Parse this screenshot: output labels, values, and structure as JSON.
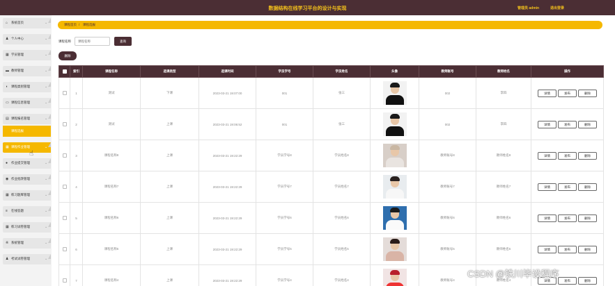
{
  "header": {
    "title": "数据结构在线学习平台的设计与实现",
    "user": "管理员 admin",
    "logout": "退出登录"
  },
  "sidebar": {
    "items": [
      {
        "label": "系统首页",
        "icon": "home-icon",
        "glyph": "⌂"
      },
      {
        "label": "个人中心",
        "icon": "user-icon",
        "glyph": "♟"
      },
      {
        "label": "学员管理",
        "icon": "grid-icon",
        "glyph": "▦"
      },
      {
        "label": "教师管理",
        "icon": "card-icon",
        "glyph": "▬"
      },
      {
        "label": "课程类别管理",
        "icon": "bullet-icon",
        "glyph": "◖"
      },
      {
        "label": "课程信息管理",
        "icon": "folder-icon",
        "glyph": "▭"
      },
      {
        "label": "课程报名管理",
        "icon": "doc-icon",
        "glyph": "▤"
      },
      {
        "label": "课程作业管理",
        "icon": "grid-icon",
        "glyph": "▦"
      },
      {
        "label": "作业提交管理",
        "icon": "drop-icon",
        "glyph": "●"
      },
      {
        "label": "作业批改管理",
        "icon": "chat-icon",
        "glyph": "◉"
      },
      {
        "label": "练习题库管理",
        "icon": "grid-icon",
        "glyph": "▦"
      },
      {
        "label": "在线答题",
        "icon": "list-icon",
        "glyph": "≡"
      },
      {
        "label": "练习试卷管理",
        "icon": "grid-icon",
        "glyph": "▦"
      },
      {
        "label": "系统管理",
        "icon": "gear-icon",
        "glyph": "※"
      },
      {
        "label": "考试试卷管理",
        "icon": "user-icon",
        "glyph": "♟"
      }
    ],
    "sub_item": "课程选报"
  },
  "breadcrumb": {
    "home": "课程首页",
    "sep": "/",
    "current": "课程选报"
  },
  "search": {
    "label": "课程名称",
    "placeholder": "课程名称",
    "button": "查询"
  },
  "delete_button": "删除",
  "table": {
    "headers": [
      "索引",
      "课程名称",
      "选课类型",
      "选课时间",
      "学员学号",
      "学员姓名",
      "头像",
      "教师账号",
      "教师姓名",
      "操作"
    ],
    "ops": [
      "详情",
      "发布",
      "删除"
    ],
    "rows": [
      {
        "idx": "1",
        "name": "测试",
        "type": "下课",
        "time": "2023-03-21 19:07:00",
        "sno": "001",
        "sname": "张三",
        "tno": "002",
        "tname": "李四",
        "avatar": "man-dark-suit"
      },
      {
        "idx": "2",
        "name": "测试",
        "type": "上课",
        "time": "2023-03-21 19:06:52",
        "sno": "001",
        "sname": "张三",
        "tno": "002",
        "tname": "李四",
        "avatar": "man-dark-suit"
      },
      {
        "idx": "3",
        "name": "课程名称8",
        "type": "上课",
        "time": "2023-03-21 19:22:29",
        "sno": "学员学号8",
        "sname": "学员姓名8",
        "tno": "教师账号8",
        "tname": "教师姓名8",
        "avatar": "woman-light"
      },
      {
        "idx": "4",
        "name": "课程名称7",
        "type": "上课",
        "time": "2023-03-21 19:22:29",
        "sno": "学员学号7",
        "sname": "学员姓名7",
        "tno": "教师账号7",
        "tname": "教师姓名7",
        "avatar": "man-white-shirt"
      },
      {
        "idx": "5",
        "name": "课程名称6",
        "type": "上课",
        "time": "2023-03-21 19:22:29",
        "sno": "学员学号6",
        "sname": "学员姓名6",
        "tno": "教师账号6",
        "tname": "教师姓名6",
        "avatar": "man-blue-bg"
      },
      {
        "idx": "6",
        "name": "课程名称5",
        "type": "上课",
        "time": "2023-03-21 19:22:29",
        "sno": "学员学号5",
        "sname": "学员姓名5",
        "tno": "教师账号5",
        "tname": "教师姓名5",
        "avatar": "woman-dark-hair"
      },
      {
        "idx": "7",
        "name": "课程名称4",
        "type": "上课",
        "time": "2023-03-21 19:22:29",
        "sno": "学员学号4",
        "sname": "学员姓名4",
        "tno": "教师账号4",
        "tname": "教师姓名4",
        "avatar": "woman-red"
      }
    ]
  },
  "watermark": "CSDN @铁川毕设程序",
  "colors": {
    "header_bg": "#4b2e34",
    "accent": "#f5b800",
    "header_text": "#f5c21b"
  }
}
